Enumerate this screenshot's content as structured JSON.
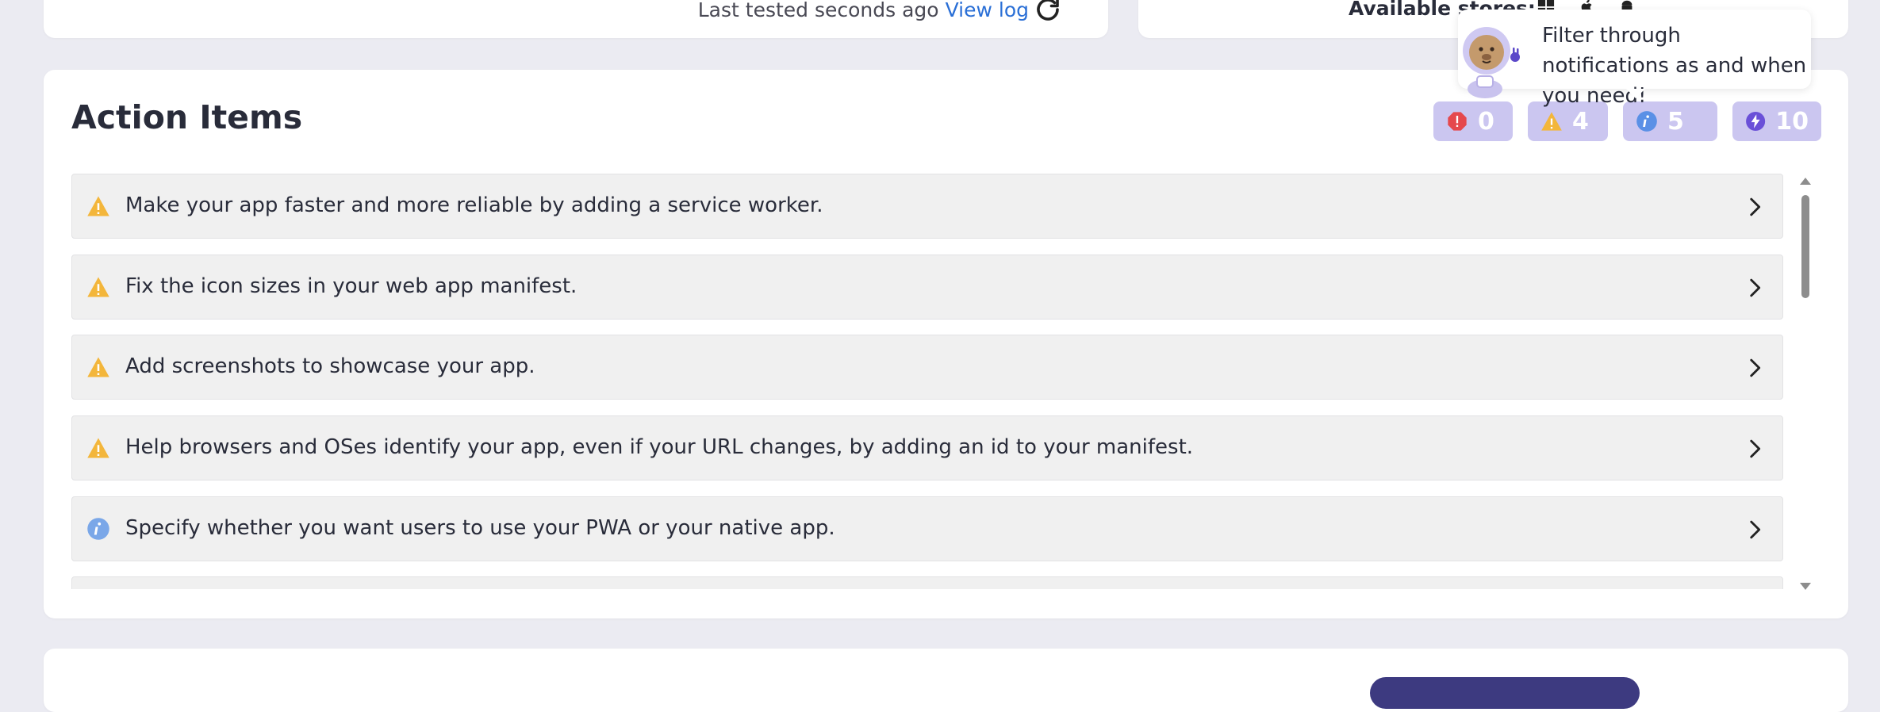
{
  "top_left_card": {
    "last_tested": "Last tested seconds ago",
    "view_log": "View log"
  },
  "top_right_card": {
    "available_stores": "Available stores:",
    "store_icons": [
      "windows-icon",
      "apple-icon",
      "android-icon"
    ]
  },
  "tooltip": {
    "text": "Filter through notifications as and when you need!",
    "mascot": "astronaut-mascot-icon"
  },
  "action_items": {
    "title": "Action Items",
    "filters": [
      {
        "name": "error",
        "icon": "error-icon",
        "count": "0",
        "color": "#e5484d"
      },
      {
        "name": "warning",
        "icon": "warning-icon",
        "count": "4",
        "color": "#f3b63b"
      },
      {
        "name": "info",
        "icon": "info-icon",
        "count": "5",
        "color": "#5a90e6"
      },
      {
        "name": "performance",
        "icon": "lightning-icon",
        "count": "10",
        "color": "#6a50d8"
      }
    ],
    "items": [
      {
        "type": "warning",
        "text": "Make your app faster and more reliable by adding a service worker."
      },
      {
        "type": "warning",
        "text": "Fix the icon sizes in your web app manifest."
      },
      {
        "type": "warning",
        "text": "Add screenshots to showcase your app."
      },
      {
        "type": "warning",
        "text": "Help browsers and OSes identify your app, even if your URL changes, by adding an id to your manifest."
      },
      {
        "type": "info",
        "text": "Specify whether you want users to use your PWA or your native app."
      }
    ]
  },
  "colors": {
    "page_bg": "#ebebf2",
    "warning": "#f3b63b",
    "info": "#7aa7e8",
    "link": "#2a6fd6",
    "filter_bg": "#cbc6f0"
  }
}
